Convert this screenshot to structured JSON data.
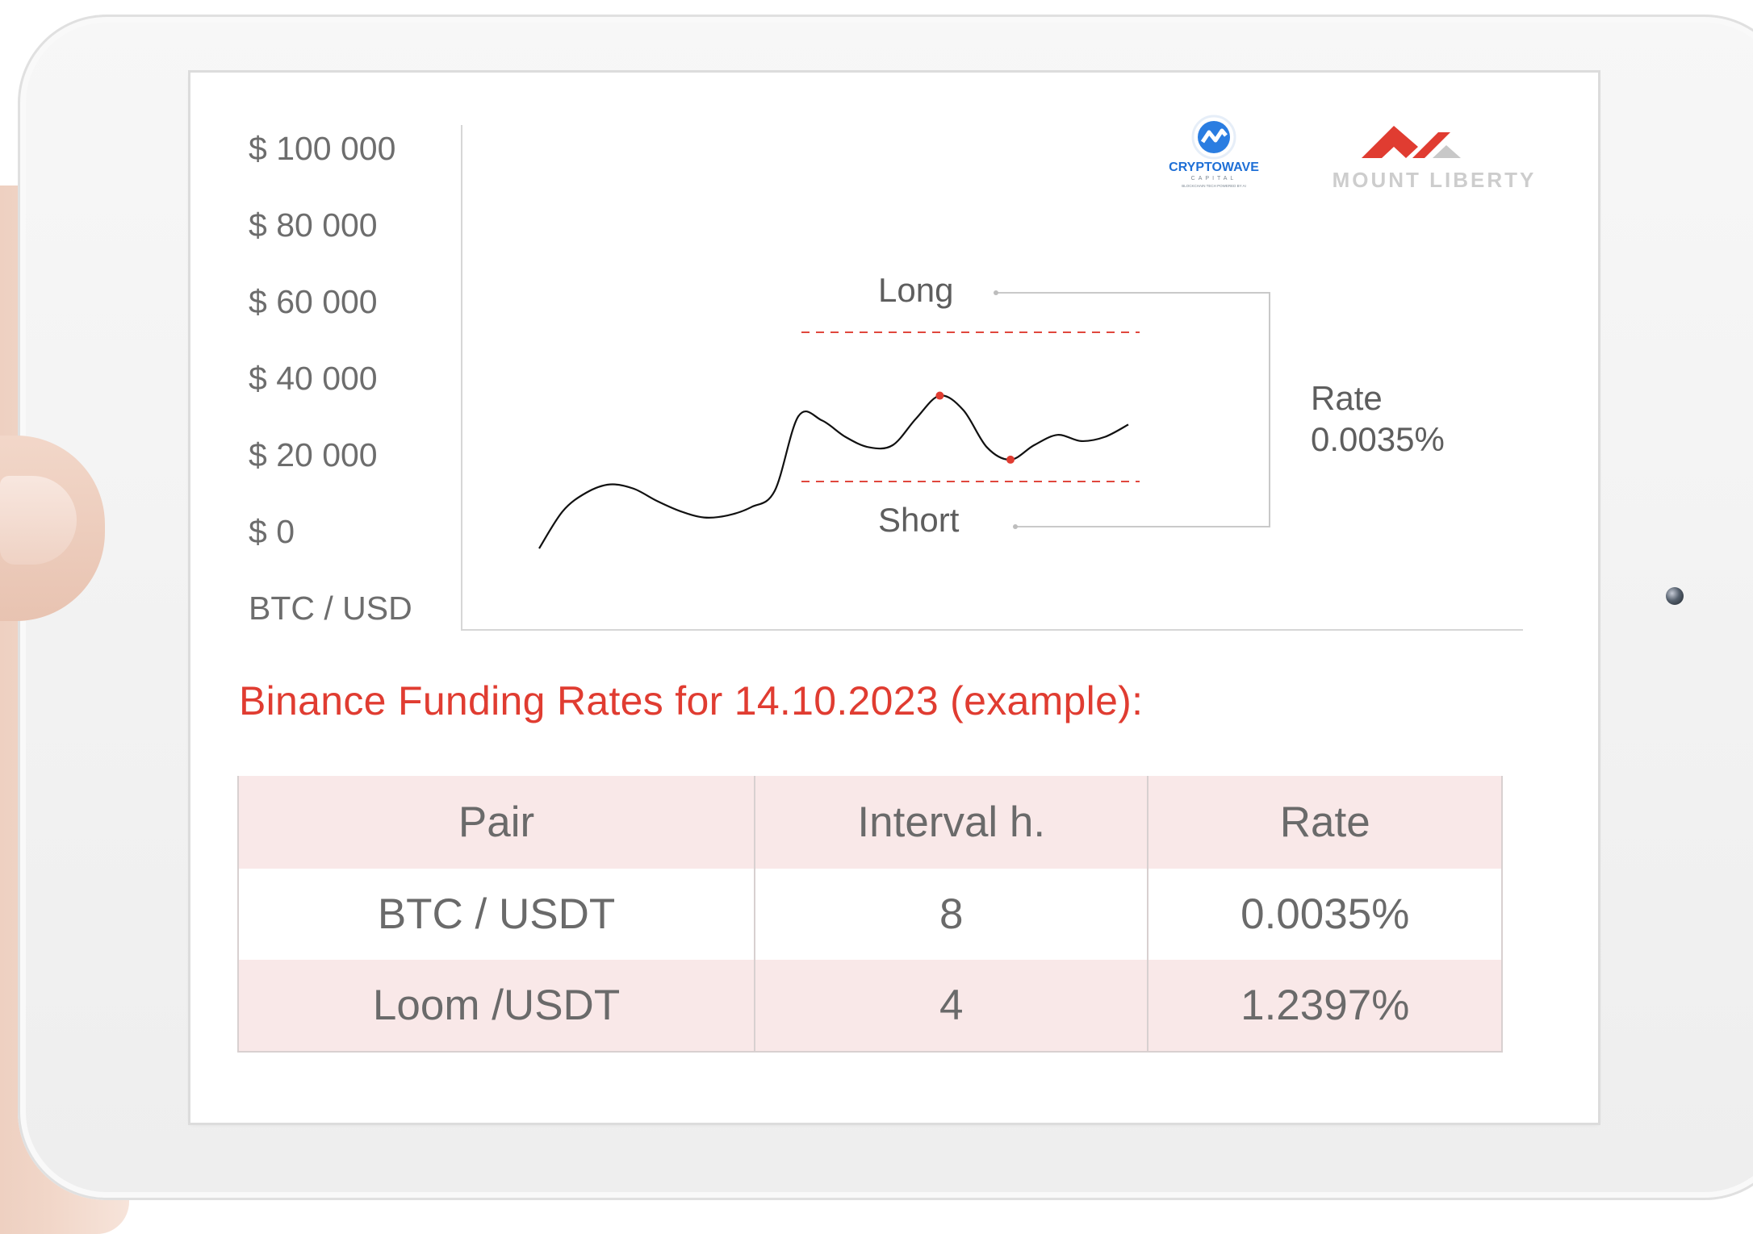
{
  "chart_data": {
    "type": "line",
    "ylabel": "BTC / USD",
    "y_ticks": [
      "$ 100 000",
      "$ 80 000",
      "$ 60 000",
      "$ 40 000",
      "$ 20 000",
      "$ 0"
    ],
    "ylim": [
      0,
      100000
    ],
    "series": [
      {
        "values": [
          0,
          9000,
          13500,
          15500,
          14500,
          11500,
          9000,
          7500,
          8000,
          10000,
          14000,
          32000,
          31000,
          27000,
          24500,
          25000,
          31500,
          37000,
          33500,
          24500,
          21500,
          25000,
          27500,
          26000,
          27000,
          30000
        ]
      }
    ],
    "annotations": {
      "long": "Long",
      "short": "Short",
      "rate_label": "Rate",
      "rate_value": "0.0035%"
    },
    "grid": false
  },
  "logos": {
    "cryptowave_name": "CRYPTOWAVE",
    "cryptowave_sub": "CAPITAL",
    "cryptowave_tag": "BLOCKCHAIN TECH POWERED BY AI",
    "mountliberty_name": "MOUNT LIBERTY"
  },
  "funding": {
    "title": "Binance Funding Rates for 14.10.2023 (example):",
    "headers": [
      "Pair",
      "Interval h.",
      "Rate"
    ],
    "rows": [
      [
        "BTC / USDT",
        "8",
        "0.0035%"
      ],
      [
        "Loom /USDT",
        "4",
        "1.2397%"
      ]
    ]
  },
  "colors": {
    "accent": "#e03c31",
    "table_band": "#f9e8e8",
    "text": "#6a6a6a"
  }
}
